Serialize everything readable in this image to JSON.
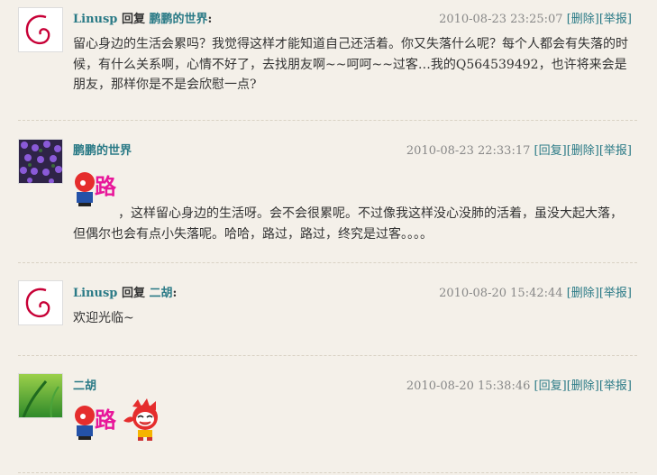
{
  "comments": [
    {
      "author": "Linusp",
      "reply_word": "回复",
      "reply_to": "鹏鹏的世界",
      "colon": ":",
      "time": "2010-08-23 23:25:07",
      "actions": [
        "[删除]",
        "[举报]"
      ],
      "text": "留心身边的生活会累吗？我觉得这样才能知道自己还活着。你又失落什么呢？每个人都会有失落的时候，有什么关系啊，心情不好了，去找朋友啊~~呵呵~~过客…我的Q564539492，也许将来会是朋友，那样你是不是会欣慰一点?"
    },
    {
      "author": "鹏鹏的世界",
      "time": "2010-08-23 22:33:17",
      "actions": [
        "[回复]",
        "[删除]",
        "[举报]"
      ],
      "text": "，这样留心身边的生活呀。会不会很累呢。不过像我这样没心没肺的活着，虽没大起大落，但偶尔也会有点小失落呢。哈哈，路过，路过，终究是过客。。。。",
      "emoji": "路"
    },
    {
      "author": "Linusp",
      "reply_word": "回复",
      "reply_to": "二胡",
      "colon": ":",
      "time": "2010-08-20 15:42:44",
      "actions": [
        "[删除]",
        "[举报]"
      ],
      "text": "欢迎光临~"
    },
    {
      "author": "二胡",
      "time": "2010-08-20 15:38:46",
      "actions": [
        "[回复]",
        "[删除]",
        "[举报]"
      ],
      "emoji": "路"
    }
  ]
}
